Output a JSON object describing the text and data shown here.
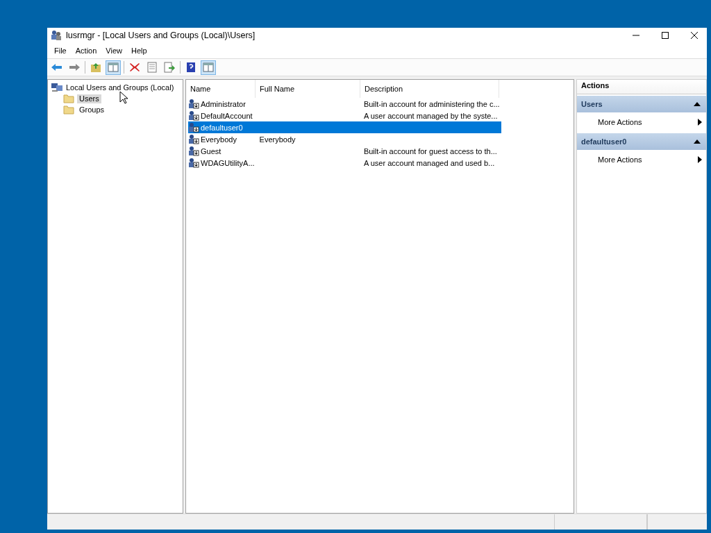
{
  "window": {
    "title": "lusrmgr - [Local Users and Groups (Local)\\Users]"
  },
  "menu": [
    "File",
    "Action",
    "View",
    "Help"
  ],
  "toolbar": [
    [
      {
        "kind": "back",
        "on": false
      },
      {
        "kind": "forward",
        "on": false
      }
    ],
    [
      {
        "kind": "up",
        "on": false
      },
      {
        "kind": "tree",
        "on": true
      }
    ],
    [
      {
        "kind": "delete",
        "on": false
      },
      {
        "kind": "properties",
        "on": false
      },
      {
        "kind": "export",
        "on": false
      }
    ],
    [
      {
        "kind": "help",
        "on": false
      },
      {
        "kind": "pane",
        "on": true
      }
    ]
  ],
  "tree": {
    "label": "Local Users and Groups (Local)",
    "children": [
      {
        "label": "Users",
        "selected": true
      },
      {
        "label": "Groups",
        "selected": false
      }
    ]
  },
  "list": {
    "columns": [
      "Name",
      "Full Name",
      "Description"
    ],
    "rows": [
      {
        "name": "Administrator",
        "description": "Built-in account for administering the c...",
        "selected": false
      },
      {
        "name": "DefaultAccount",
        "description": "A user account managed by the syste...",
        "selected": false
      },
      {
        "name": "defaultuser0",
        "selected": true
      },
      {
        "name": "Everybody",
        "full_name": "Everybody",
        "selected": false
      },
      {
        "name": "Guest",
        "description": "Built-in account for guest access to th...",
        "selected": false
      },
      {
        "name": "WDAGUtilityA...",
        "description": "A user account managed and used b...",
        "selected": false
      }
    ]
  },
  "actions": {
    "title": "Actions",
    "sections": [
      {
        "title": "Users",
        "expanded": true,
        "items": [
          "More Actions"
        ]
      },
      {
        "title": "defaultuser0",
        "expanded": true,
        "items": [
          "More Actions"
        ]
      }
    ]
  }
}
